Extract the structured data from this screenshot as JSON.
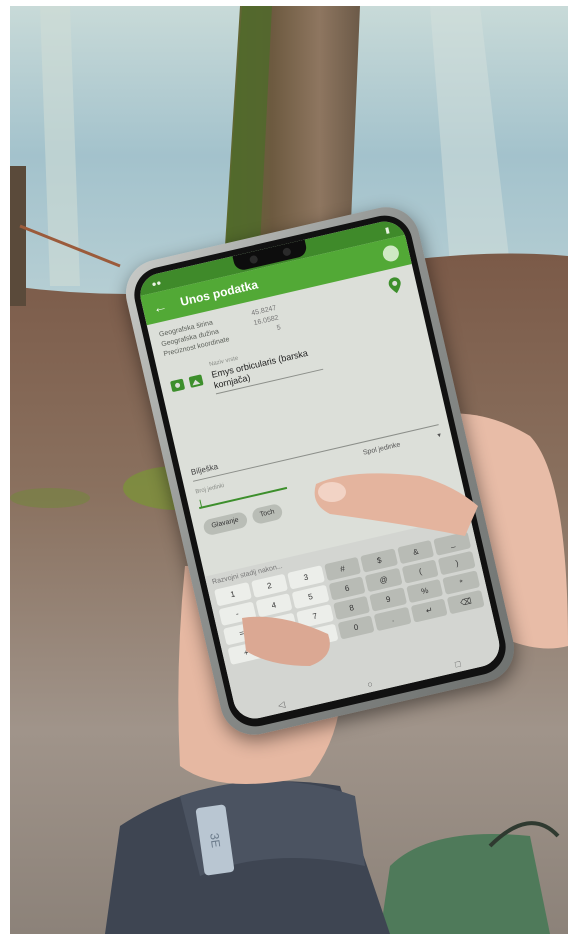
{
  "colors": {
    "app_green": "#52a936",
    "status_green": "#3f8a2a",
    "icon_green": "#3d8f2c",
    "water": "#a9c7cf",
    "leaves": "#8a6a55",
    "ground": "#9a8a7a",
    "sleeve": "#3e4552"
  },
  "app": {
    "back_icon": "arrow-left-icon",
    "title": "Unos podatka",
    "coords": {
      "lat_label": "Geografska širina",
      "lat_value": "45.8247",
      "lon_label": "Geografska dužina",
      "lon_value": "16.0582",
      "prec_label": "Preciznost koordinate",
      "prec_value": "5"
    },
    "species_label": "Naziv vrste",
    "species_value": "Emys orbicularis (barska kornjača)",
    "note_label": "Bilješka",
    "count_label": "Broj jedinki",
    "sex_label": "Spol jedinke",
    "chip_1": "Glavanje",
    "chip_2": "Toch",
    "keyboard_hint": "Razvojni stadij nakon..."
  },
  "keyboard": {
    "keys": [
      "1",
      "2",
      "3",
      "#",
      "$",
      "&",
      "_",
      "-",
      "4",
      "5",
      "6",
      "@",
      "(",
      ")",
      "=",
      "/",
      "7",
      "8",
      "9",
      "%",
      "*",
      "+",
      "<",
      ",",
      "0",
      ".",
      "↵",
      "⌫"
    ]
  },
  "sleeve_badge": "3E"
}
